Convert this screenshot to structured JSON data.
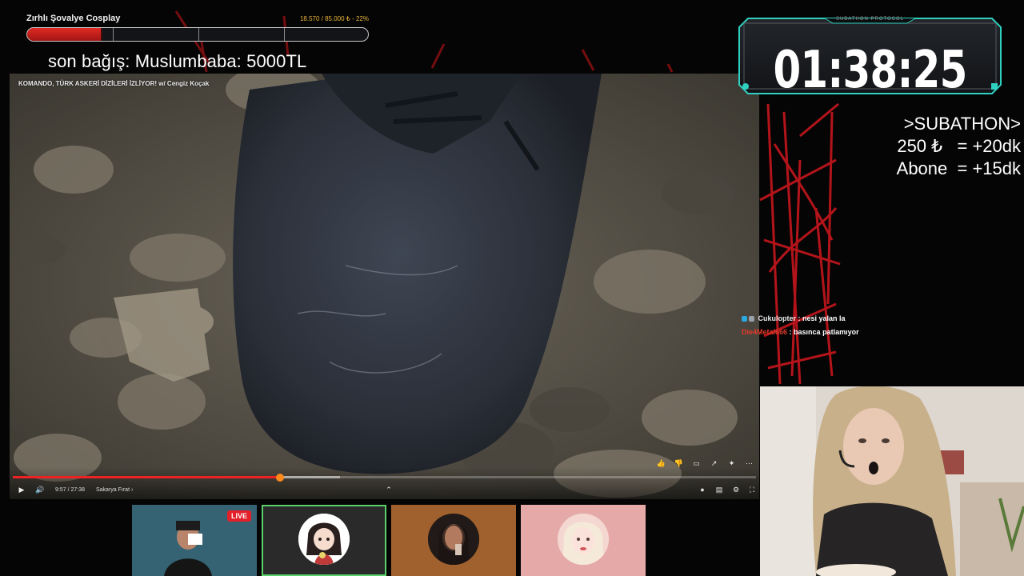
{
  "goal": {
    "title": "Zırhlı Şovalye Cosplay",
    "amount_text": "18.570 / 85.000 ₺ - 22%",
    "progress_fraction": 0.22
  },
  "last_donation": "son bağış: Muslumbaba: 5000TL",
  "video": {
    "title": "KOMANDO, TÜRK ASKERİ DİZİLERİ İZLİYOR! w/ Cengiz Koçak",
    "time": "9:57 / 27:38",
    "chapter": "Sakarya Fırat ›",
    "played_fraction": 0.36,
    "buffered_fraction": 0.44
  },
  "timer": {
    "label": "SUBATHON PROTOCOL",
    "value": "01:38:25"
  },
  "rules": {
    "heading": ">SUBATHON>",
    "line1": "250 ₺   = +20dk",
    "line2": "Abone  = +15dk"
  },
  "chat": [
    {
      "user": "Cukulopter",
      "separator": " : ",
      "message": "nesi yalan la",
      "color": "#e8e8e8"
    },
    {
      "user": "Die4Metal666",
      "separator": " : ",
      "message": "basınca patlamıyor",
      "color": "#e03a2a"
    }
  ],
  "participants": {
    "live_label": "LIVE"
  },
  "icons": {
    "play": "▶",
    "volume": "🔊",
    "chevron_up": "⌃",
    "like": "👍",
    "dislike": "👎",
    "comment": "▭",
    "share": "↗",
    "clip": "✦",
    "more": "⋯",
    "autoplay": "●",
    "subtitles": "▤",
    "settings": "⚙",
    "fullscreen": "⛶"
  },
  "colors": {
    "accent_red": "#e02a24",
    "timer_frame": "#2fd0c0",
    "live_red": "#e3202a",
    "active_green": "#5ad06a"
  }
}
